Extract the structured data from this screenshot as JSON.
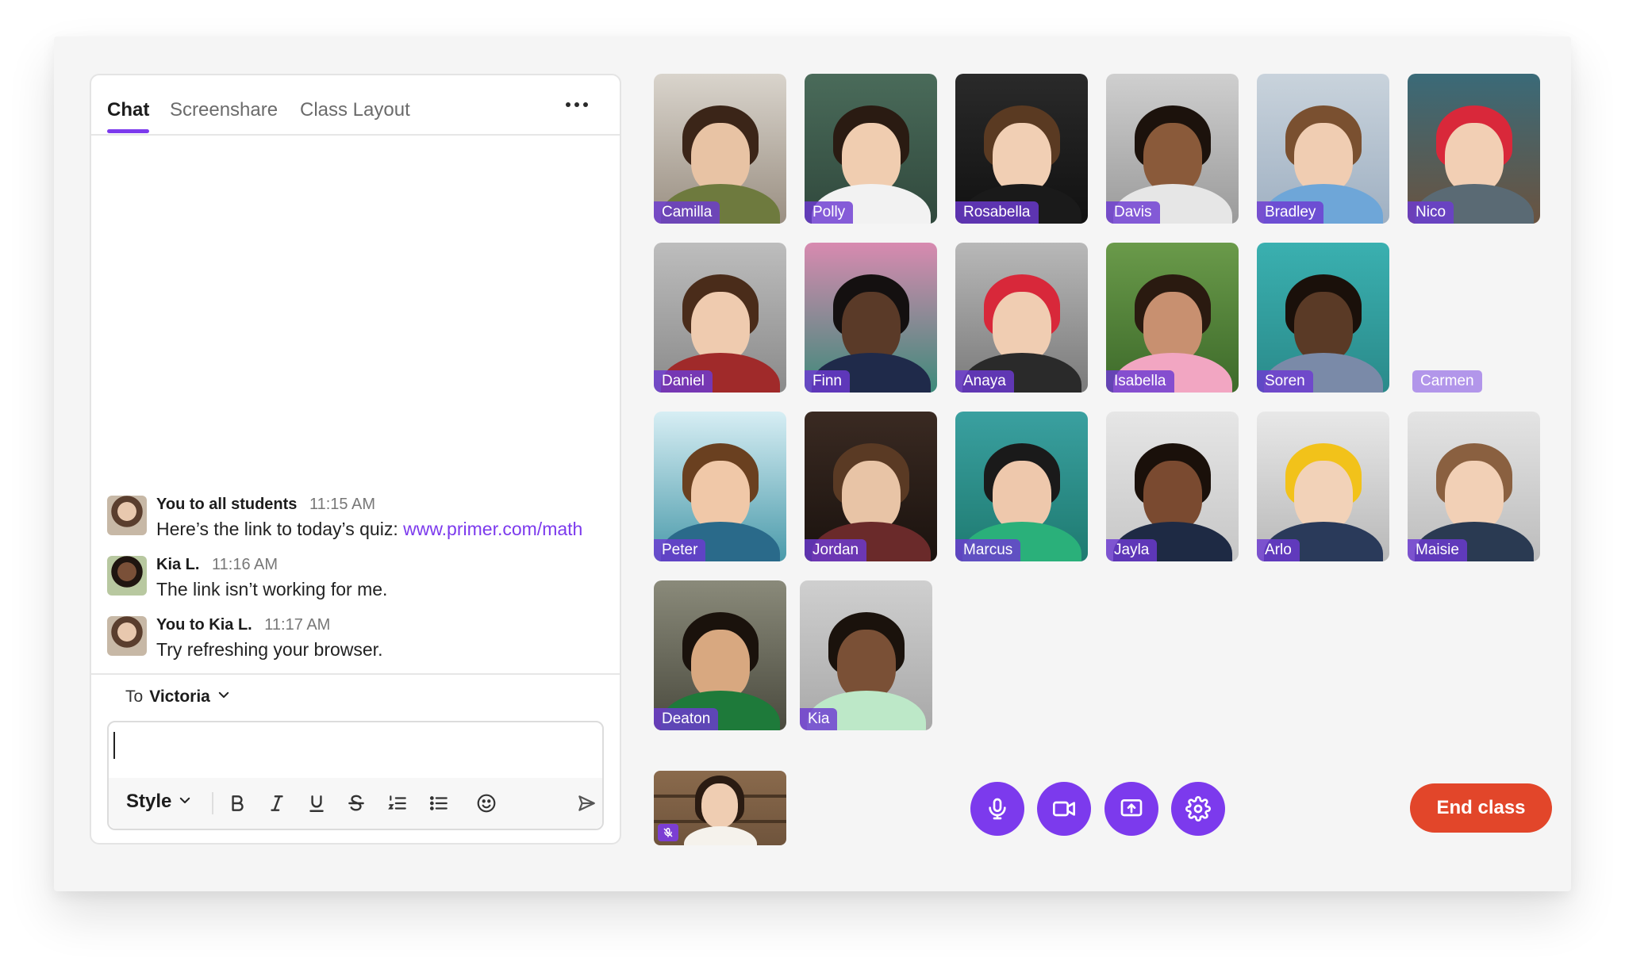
{
  "chat": {
    "tabs": [
      {
        "label": "Chat"
      },
      {
        "label": "Screenshare"
      },
      {
        "label": "Class Layout"
      }
    ],
    "messages": [
      {
        "sender": "You to all students",
        "time": "11:15 AM",
        "text": "Here’s the link to today’s quiz: ",
        "link": "www.primer.com/math"
      },
      {
        "sender": "Kia L.",
        "time": "11:16 AM",
        "text": "The link isn’t working for me."
      },
      {
        "sender": "You to Kia L.",
        "time": "11:17 AM",
        "text": "Try refreshing your browser."
      }
    ],
    "recipient": {
      "prefix": "To",
      "name": "Victoria"
    },
    "composer": {
      "style_label": "Style",
      "value": ""
    }
  },
  "students": [
    {
      "name": "Camilla"
    },
    {
      "name": "Polly"
    },
    {
      "name": "Rosabella"
    },
    {
      "name": "Davis"
    },
    {
      "name": "Bradley"
    },
    {
      "name": "Nico"
    },
    {
      "name": "Daniel"
    },
    {
      "name": "Finn"
    },
    {
      "name": "Anaya"
    },
    {
      "name": "Isabella"
    },
    {
      "name": "Soren"
    },
    {
      "name": "Carmen"
    },
    {
      "name": "Peter"
    },
    {
      "name": "Jordan"
    },
    {
      "name": "Marcus"
    },
    {
      "name": "Jayla"
    },
    {
      "name": "Arlo"
    },
    {
      "name": "Maisie"
    },
    {
      "name": "Deaton"
    },
    {
      "name": "Kia"
    }
  ],
  "controls": {
    "end_class_label": "End class",
    "buttons": [
      "microphone-icon",
      "video-camera-icon",
      "screenshare-icon",
      "settings-gear-icon"
    ]
  },
  "colors": {
    "accent": "#7c3aed",
    "end_class": "#e2462a",
    "name_tag": "#6d3ad2"
  }
}
